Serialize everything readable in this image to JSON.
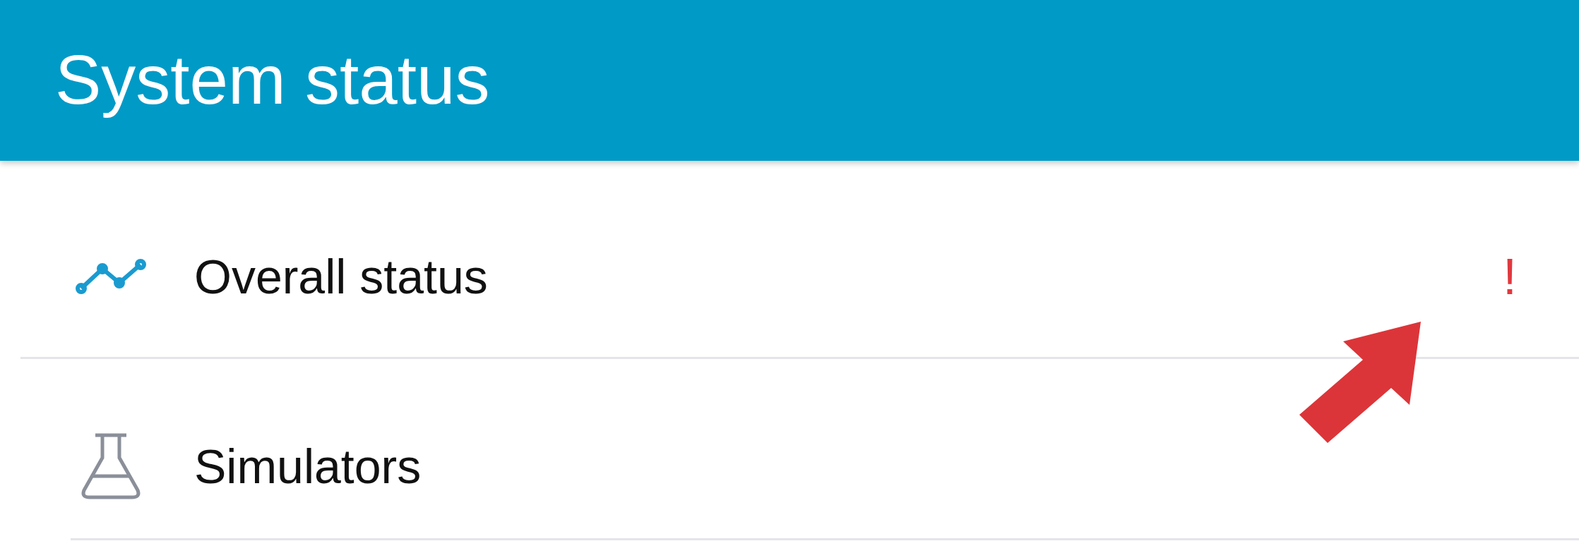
{
  "header": {
    "title": "System status"
  },
  "items": [
    {
      "label": "Overall status",
      "kind": "trend",
      "badge": "!"
    },
    {
      "label": "Simulators",
      "kind": "flask"
    }
  ]
}
